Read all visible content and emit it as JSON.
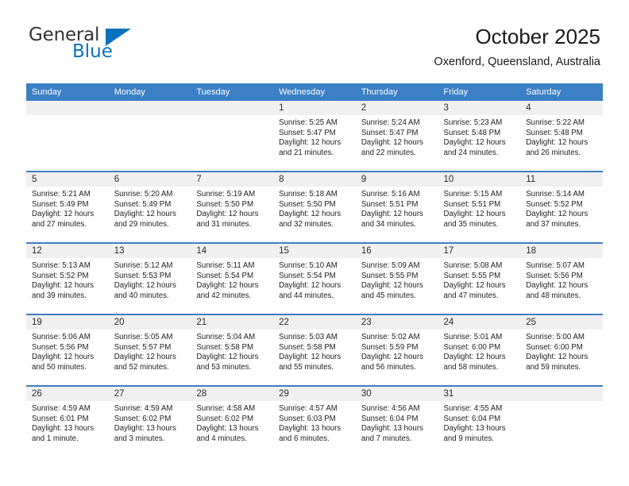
{
  "brand": {
    "name_part1": "General",
    "name_part2": "Blue",
    "triangle_icon": "blue-triangle-icon",
    "accent_color": "#0a72bd"
  },
  "header": {
    "title": "October 2025",
    "subtitle": "Oxenford, Queensland, Australia"
  },
  "calendar": {
    "header_color": "#3b7fc4",
    "daynum_band_color": "#f0f0f0",
    "weekdays": [
      "Sunday",
      "Monday",
      "Tuesday",
      "Wednesday",
      "Thursday",
      "Friday",
      "Saturday"
    ],
    "weeks": [
      [
        {
          "empty": true
        },
        {
          "empty": true
        },
        {
          "empty": true
        },
        {
          "day": "1",
          "sunrise": "Sunrise: 5:25 AM",
          "sunset": "Sunset: 5:47 PM",
          "daylight": "Daylight: 12 hours and 21 minutes."
        },
        {
          "day": "2",
          "sunrise": "Sunrise: 5:24 AM",
          "sunset": "Sunset: 5:47 PM",
          "daylight": "Daylight: 12 hours and 22 minutes."
        },
        {
          "day": "3",
          "sunrise": "Sunrise: 5:23 AM",
          "sunset": "Sunset: 5:48 PM",
          "daylight": "Daylight: 12 hours and 24 minutes."
        },
        {
          "day": "4",
          "sunrise": "Sunrise: 5:22 AM",
          "sunset": "Sunset: 5:48 PM",
          "daylight": "Daylight: 12 hours and 26 minutes."
        }
      ],
      [
        {
          "day": "5",
          "sunrise": "Sunrise: 5:21 AM",
          "sunset": "Sunset: 5:49 PM",
          "daylight": "Daylight: 12 hours and 27 minutes."
        },
        {
          "day": "6",
          "sunrise": "Sunrise: 5:20 AM",
          "sunset": "Sunset: 5:49 PM",
          "daylight": "Daylight: 12 hours and 29 minutes."
        },
        {
          "day": "7",
          "sunrise": "Sunrise: 5:19 AM",
          "sunset": "Sunset: 5:50 PM",
          "daylight": "Daylight: 12 hours and 31 minutes."
        },
        {
          "day": "8",
          "sunrise": "Sunrise: 5:18 AM",
          "sunset": "Sunset: 5:50 PM",
          "daylight": "Daylight: 12 hours and 32 minutes."
        },
        {
          "day": "9",
          "sunrise": "Sunrise: 5:16 AM",
          "sunset": "Sunset: 5:51 PM",
          "daylight": "Daylight: 12 hours and 34 minutes."
        },
        {
          "day": "10",
          "sunrise": "Sunrise: 5:15 AM",
          "sunset": "Sunset: 5:51 PM",
          "daylight": "Daylight: 12 hours and 35 minutes."
        },
        {
          "day": "11",
          "sunrise": "Sunrise: 5:14 AM",
          "sunset": "Sunset: 5:52 PM",
          "daylight": "Daylight: 12 hours and 37 minutes."
        }
      ],
      [
        {
          "day": "12",
          "sunrise": "Sunrise: 5:13 AM",
          "sunset": "Sunset: 5:52 PM",
          "daylight": "Daylight: 12 hours and 39 minutes."
        },
        {
          "day": "13",
          "sunrise": "Sunrise: 5:12 AM",
          "sunset": "Sunset: 5:53 PM",
          "daylight": "Daylight: 12 hours and 40 minutes."
        },
        {
          "day": "14",
          "sunrise": "Sunrise: 5:11 AM",
          "sunset": "Sunset: 5:54 PM",
          "daylight": "Daylight: 12 hours and 42 minutes."
        },
        {
          "day": "15",
          "sunrise": "Sunrise: 5:10 AM",
          "sunset": "Sunset: 5:54 PM",
          "daylight": "Daylight: 12 hours and 44 minutes."
        },
        {
          "day": "16",
          "sunrise": "Sunrise: 5:09 AM",
          "sunset": "Sunset: 5:55 PM",
          "daylight": "Daylight: 12 hours and 45 minutes."
        },
        {
          "day": "17",
          "sunrise": "Sunrise: 5:08 AM",
          "sunset": "Sunset: 5:55 PM",
          "daylight": "Daylight: 12 hours and 47 minutes."
        },
        {
          "day": "18",
          "sunrise": "Sunrise: 5:07 AM",
          "sunset": "Sunset: 5:56 PM",
          "daylight": "Daylight: 12 hours and 48 minutes."
        }
      ],
      [
        {
          "day": "19",
          "sunrise": "Sunrise: 5:06 AM",
          "sunset": "Sunset: 5:56 PM",
          "daylight": "Daylight: 12 hours and 50 minutes."
        },
        {
          "day": "20",
          "sunrise": "Sunrise: 5:05 AM",
          "sunset": "Sunset: 5:57 PM",
          "daylight": "Daylight: 12 hours and 52 minutes."
        },
        {
          "day": "21",
          "sunrise": "Sunrise: 5:04 AM",
          "sunset": "Sunset: 5:58 PM",
          "daylight": "Daylight: 12 hours and 53 minutes."
        },
        {
          "day": "22",
          "sunrise": "Sunrise: 5:03 AM",
          "sunset": "Sunset: 5:58 PM",
          "daylight": "Daylight: 12 hours and 55 minutes."
        },
        {
          "day": "23",
          "sunrise": "Sunrise: 5:02 AM",
          "sunset": "Sunset: 5:59 PM",
          "daylight": "Daylight: 12 hours and 56 minutes."
        },
        {
          "day": "24",
          "sunrise": "Sunrise: 5:01 AM",
          "sunset": "Sunset: 6:00 PM",
          "daylight": "Daylight: 12 hours and 58 minutes."
        },
        {
          "day": "25",
          "sunrise": "Sunrise: 5:00 AM",
          "sunset": "Sunset: 6:00 PM",
          "daylight": "Daylight: 12 hours and 59 minutes."
        }
      ],
      [
        {
          "day": "26",
          "sunrise": "Sunrise: 4:59 AM",
          "sunset": "Sunset: 6:01 PM",
          "daylight": "Daylight: 13 hours and 1 minute."
        },
        {
          "day": "27",
          "sunrise": "Sunrise: 4:59 AM",
          "sunset": "Sunset: 6:02 PM",
          "daylight": "Daylight: 13 hours and 3 minutes."
        },
        {
          "day": "28",
          "sunrise": "Sunrise: 4:58 AM",
          "sunset": "Sunset: 6:02 PM",
          "daylight": "Daylight: 13 hours and 4 minutes."
        },
        {
          "day": "29",
          "sunrise": "Sunrise: 4:57 AM",
          "sunset": "Sunset: 6:03 PM",
          "daylight": "Daylight: 13 hours and 6 minutes."
        },
        {
          "day": "30",
          "sunrise": "Sunrise: 4:56 AM",
          "sunset": "Sunset: 6:04 PM",
          "daylight": "Daylight: 13 hours and 7 minutes."
        },
        {
          "day": "31",
          "sunrise": "Sunrise: 4:55 AM",
          "sunset": "Sunset: 6:04 PM",
          "daylight": "Daylight: 13 hours and 9 minutes."
        },
        {
          "empty": true
        }
      ]
    ]
  }
}
